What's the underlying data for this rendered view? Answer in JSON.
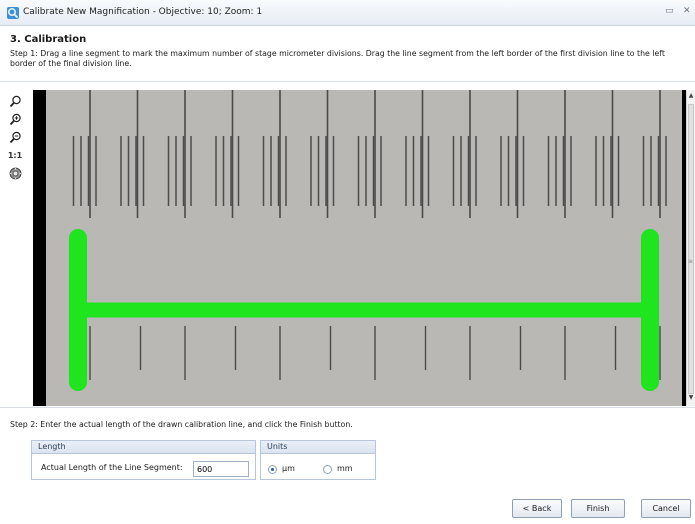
{
  "window": {
    "title": "Calibrate New Magnification - Objective: 10; Zoom: 1",
    "minimize_glyph": "▭",
    "close_glyph": "✕"
  },
  "step": {
    "heading": "3. Calibration",
    "step1_text": "Step 1: Drag a line segment to mark the maximum number of stage micrometer divisions. Drag the line segment from the left border of the first division line to the left border of the final division line.",
    "step2_text": "Step 2: Enter the actual length of the drawn calibration line, and click the Finish button."
  },
  "toolbar": {
    "tools": [
      {
        "icon": "zoom-icon"
      },
      {
        "icon": "zoom-in-icon"
      },
      {
        "icon": "zoom-out-icon"
      },
      {
        "icon": "actual-size-icon",
        "label": "1:1"
      },
      {
        "icon": "pan-icon"
      }
    ]
  },
  "viewer": {
    "image": "stage-micrometer",
    "calibration_line_color": "#1ee51e",
    "vscroll_up": "▲",
    "vscroll_grip": "≡",
    "vscroll_down": "▼"
  },
  "length_group": {
    "header": "Length",
    "field_label": "Actual Length of the Line Segment:",
    "field_value": "600"
  },
  "units_group": {
    "header": "Units",
    "options": [
      {
        "label": "µm",
        "selected": true
      },
      {
        "label": "mm",
        "selected": false
      }
    ]
  },
  "buttons": {
    "back": "< Back",
    "finish": "Finish",
    "cancel": "Cancel"
  },
  "colors": {
    "accent": "#2a5aa8",
    "calibration_line": "#1ee51e",
    "group_border": "#b7c6da"
  }
}
